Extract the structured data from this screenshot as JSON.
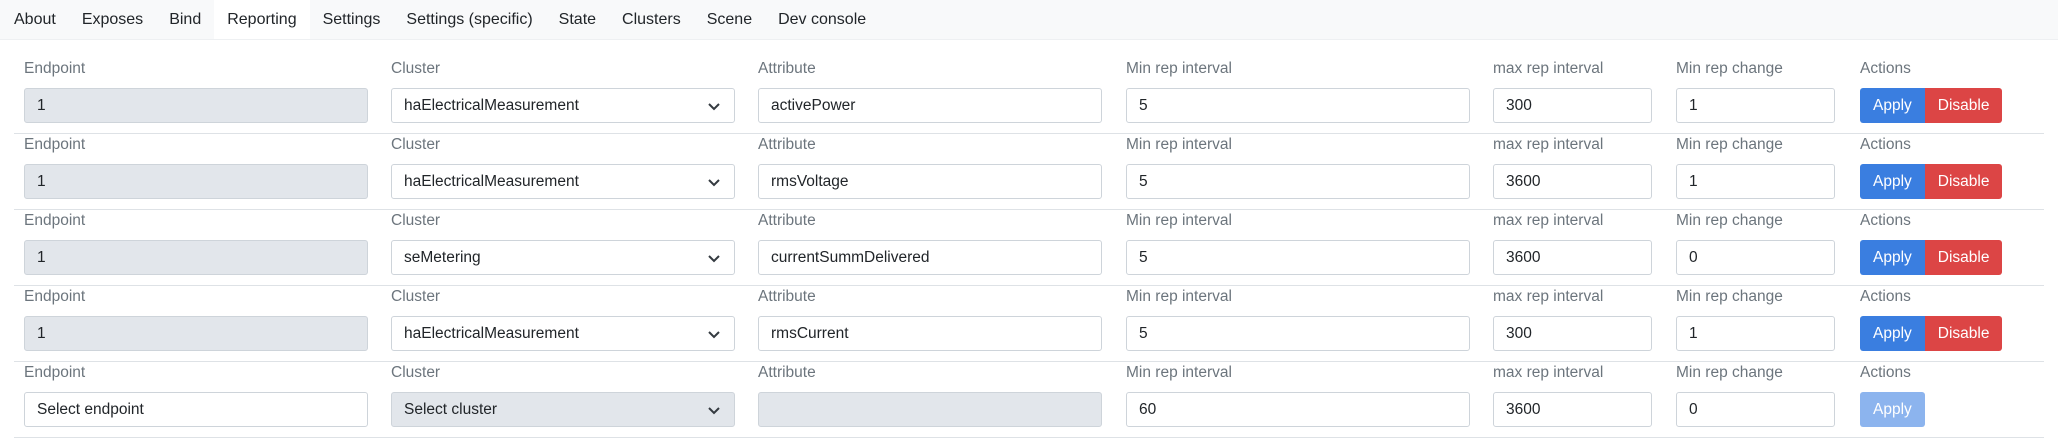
{
  "tabs": [
    {
      "label": "About"
    },
    {
      "label": "Exposes"
    },
    {
      "label": "Bind"
    },
    {
      "label": "Reporting",
      "active": true
    },
    {
      "label": "Settings"
    },
    {
      "label": "Settings (specific)"
    },
    {
      "label": "State"
    },
    {
      "label": "Clusters"
    },
    {
      "label": "Scene"
    },
    {
      "label": "Dev console"
    }
  ],
  "labels": {
    "endpoint": "Endpoint",
    "cluster": "Cluster",
    "attribute": "Attribute",
    "min_rep_interval": "Min rep interval",
    "max_rep_interval": "max rep interval",
    "min_rep_change": "Min rep change",
    "actions": "Actions"
  },
  "buttons": {
    "apply": "Apply",
    "disable": "Disable"
  },
  "rows": [
    {
      "endpoint": "1",
      "cluster": "haElectricalMeasurement",
      "attribute": "activePower",
      "min_rep_interval": "5",
      "max_rep_interval": "300",
      "min_rep_change": "1"
    },
    {
      "endpoint": "1",
      "cluster": "haElectricalMeasurement",
      "attribute": "rmsVoltage",
      "min_rep_interval": "5",
      "max_rep_interval": "3600",
      "min_rep_change": "1"
    },
    {
      "endpoint": "1",
      "cluster": "seMetering",
      "attribute": "currentSummDelivered",
      "min_rep_interval": "5",
      "max_rep_interval": "3600",
      "min_rep_change": "0"
    },
    {
      "endpoint": "1",
      "cluster": "haElectricalMeasurement",
      "attribute": "rmsCurrent",
      "min_rep_interval": "5",
      "max_rep_interval": "300",
      "min_rep_change": "1"
    }
  ],
  "new_row": {
    "endpoint": "Select endpoint",
    "cluster": "Select cluster",
    "attribute": "",
    "min_rep_interval": "60",
    "max_rep_interval": "3600",
    "min_rep_change": "0"
  },
  "colors": {
    "apply": "#3a7ee0",
    "disable": "#dc4545",
    "apply_disabled": "#8cb4ee",
    "disabled_field": "#e2e6eb"
  },
  "icons": {
    "select_arrow": "chevron-down-icon"
  }
}
